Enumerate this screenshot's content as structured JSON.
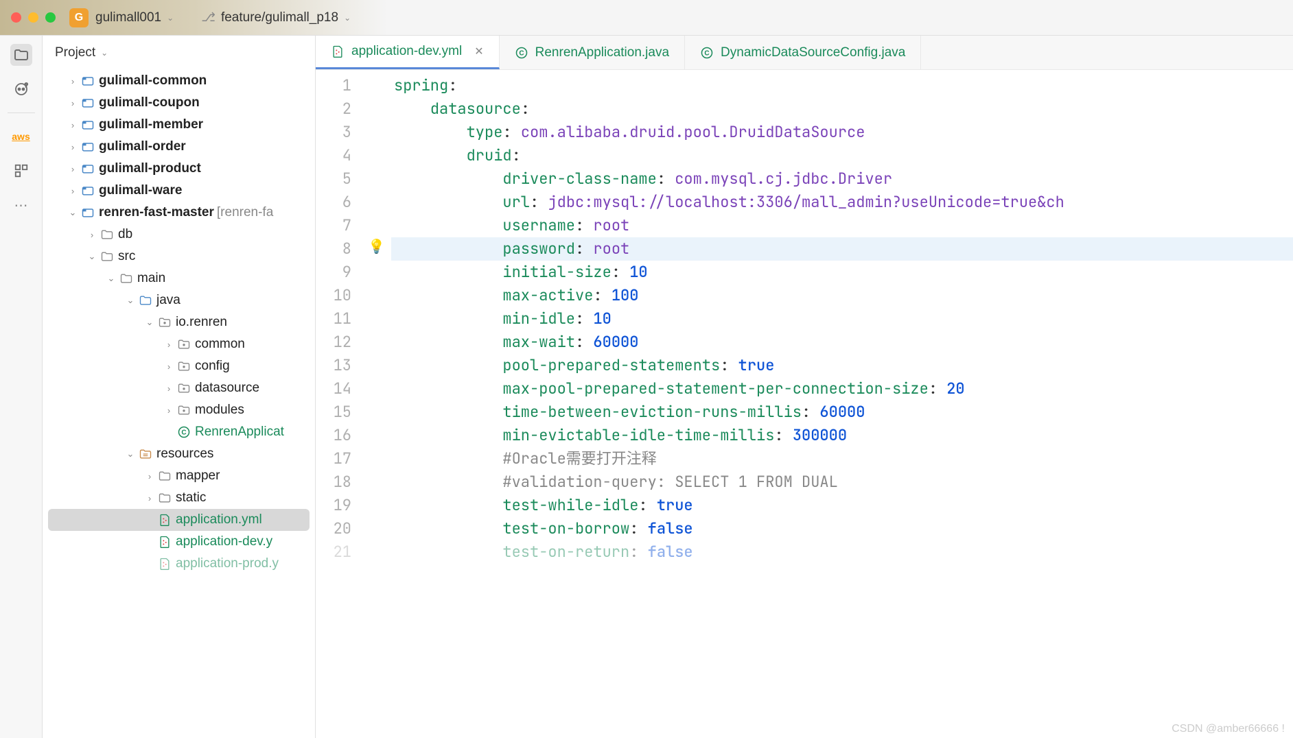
{
  "titlebar": {
    "project_badge": "G",
    "project_name": "gulimall001",
    "branch_name": "feature/gulimall_p18"
  },
  "leftbar": {
    "icons": [
      "folder",
      "copilot",
      "aws",
      "structure",
      "more"
    ]
  },
  "panel": {
    "title": "Project"
  },
  "tree": [
    {
      "indent": 1,
      "arrow": "right",
      "icon": "module",
      "label": "gulimall-common",
      "bold": true
    },
    {
      "indent": 1,
      "arrow": "right",
      "icon": "module",
      "label": "gulimall-coupon",
      "bold": true
    },
    {
      "indent": 1,
      "arrow": "right",
      "icon": "module",
      "label": "gulimall-member",
      "bold": true
    },
    {
      "indent": 1,
      "arrow": "right",
      "icon": "module",
      "label": "gulimall-order",
      "bold": true
    },
    {
      "indent": 1,
      "arrow": "right",
      "icon": "module",
      "label": "gulimall-product",
      "bold": true
    },
    {
      "indent": 1,
      "arrow": "right",
      "icon": "module",
      "label": "gulimall-ware",
      "bold": true
    },
    {
      "indent": 1,
      "arrow": "down",
      "icon": "module",
      "label": "renren-fast-master",
      "bold": true,
      "annot": " [renren-fa"
    },
    {
      "indent": 2,
      "arrow": "right",
      "icon": "dir",
      "label": "db"
    },
    {
      "indent": 2,
      "arrow": "down",
      "icon": "dir",
      "label": "src"
    },
    {
      "indent": 3,
      "arrow": "down",
      "icon": "dir",
      "label": "main"
    },
    {
      "indent": 4,
      "arrow": "down",
      "icon": "srcfolder",
      "label": "java"
    },
    {
      "indent": 5,
      "arrow": "down",
      "icon": "pkg",
      "label": "io.renren"
    },
    {
      "indent": 6,
      "arrow": "right",
      "icon": "pkg",
      "label": "common"
    },
    {
      "indent": 6,
      "arrow": "right",
      "icon": "pkg",
      "label": "config"
    },
    {
      "indent": 6,
      "arrow": "right",
      "icon": "pkg",
      "label": "datasource"
    },
    {
      "indent": 6,
      "arrow": "right",
      "icon": "pkg",
      "label": "modules"
    },
    {
      "indent": 6,
      "arrow": "none",
      "icon": "class",
      "label": "RenrenApplicat",
      "green": true
    },
    {
      "indent": 4,
      "arrow": "down",
      "icon": "resfolder",
      "label": "resources"
    },
    {
      "indent": 5,
      "arrow": "right",
      "icon": "folder",
      "label": "mapper"
    },
    {
      "indent": 5,
      "arrow": "right",
      "icon": "folder",
      "label": "static"
    },
    {
      "indent": 5,
      "arrow": "none",
      "icon": "yml",
      "label": "application.yml",
      "green": true,
      "selected": true
    },
    {
      "indent": 5,
      "arrow": "none",
      "icon": "yml",
      "label": "application-dev.yml",
      "green": true,
      "trunc": "application-dev.y"
    },
    {
      "indent": 5,
      "arrow": "none",
      "icon": "yml",
      "label": "application-prod.yml",
      "green": true,
      "trunc": "application-prod.y",
      "faded": true
    }
  ],
  "tabs": [
    {
      "icon": "yml",
      "label": "application-dev.yml",
      "active": true,
      "closable": true
    },
    {
      "icon": "class",
      "label": "RenrenApplication.java"
    },
    {
      "icon": "class",
      "label": "DynamicDataSourceConfig.java"
    }
  ],
  "code_lines": [
    {
      "n": 1,
      "segs": [
        [
          "k",
          "spring"
        ],
        [
          "colon",
          ":"
        ]
      ]
    },
    {
      "n": 2,
      "segs": [
        [
          "",
          "    "
        ],
        [
          "k",
          "datasource"
        ],
        [
          "colon",
          ":"
        ]
      ]
    },
    {
      "n": 3,
      "segs": [
        [
          "",
          "        "
        ],
        [
          "k",
          "type"
        ],
        [
          "colon",
          ": "
        ],
        [
          "s",
          "com.alibaba.druid.pool.DruidDataSource"
        ]
      ]
    },
    {
      "n": 4,
      "segs": [
        [
          "",
          "        "
        ],
        [
          "k",
          "druid"
        ],
        [
          "colon",
          ":"
        ]
      ]
    },
    {
      "n": 5,
      "segs": [
        [
          "",
          "            "
        ],
        [
          "k",
          "driver-class-name"
        ],
        [
          "colon",
          ": "
        ],
        [
          "s",
          "com.mysql.cj.jdbc.Driver"
        ]
      ]
    },
    {
      "n": 6,
      "segs": [
        [
          "",
          "            "
        ],
        [
          "k",
          "url"
        ],
        [
          "colon",
          ": "
        ],
        [
          "s",
          "jdbc:mysql://localhost:3306/mall_admin?useUnicode=true&ch"
        ]
      ]
    },
    {
      "n": 7,
      "segs": [
        [
          "",
          "            "
        ],
        [
          "k",
          "username"
        ],
        [
          "colon",
          ": "
        ],
        [
          "s",
          "root"
        ]
      ]
    },
    {
      "n": 8,
      "hl": true,
      "segs": [
        [
          "",
          "            "
        ],
        [
          "k",
          "password"
        ],
        [
          "colon",
          ": "
        ],
        [
          "s",
          "root"
        ]
      ]
    },
    {
      "n": 9,
      "segs": [
        [
          "",
          "            "
        ],
        [
          "k",
          "initial-size"
        ],
        [
          "colon",
          ": "
        ],
        [
          "v",
          "10"
        ]
      ]
    },
    {
      "n": 10,
      "segs": [
        [
          "",
          "            "
        ],
        [
          "k",
          "max-active"
        ],
        [
          "colon",
          ": "
        ],
        [
          "v",
          "100"
        ]
      ]
    },
    {
      "n": 11,
      "segs": [
        [
          "",
          "            "
        ],
        [
          "k",
          "min-idle"
        ],
        [
          "colon",
          ": "
        ],
        [
          "v",
          "10"
        ]
      ]
    },
    {
      "n": 12,
      "segs": [
        [
          "",
          "            "
        ],
        [
          "k",
          "max-wait"
        ],
        [
          "colon",
          ": "
        ],
        [
          "v",
          "60000"
        ]
      ]
    },
    {
      "n": 13,
      "segs": [
        [
          "",
          "            "
        ],
        [
          "k",
          "pool-prepared-statements"
        ],
        [
          "colon",
          ": "
        ],
        [
          "v",
          "true"
        ]
      ]
    },
    {
      "n": 14,
      "segs": [
        [
          "",
          "            "
        ],
        [
          "k",
          "max-pool-prepared-statement-per-connection-size"
        ],
        [
          "colon",
          ": "
        ],
        [
          "v",
          "20"
        ]
      ]
    },
    {
      "n": 15,
      "segs": [
        [
          "",
          "            "
        ],
        [
          "k",
          "time-between-eviction-runs-millis"
        ],
        [
          "colon",
          ": "
        ],
        [
          "v",
          "60000"
        ]
      ]
    },
    {
      "n": 16,
      "segs": [
        [
          "",
          "            "
        ],
        [
          "k",
          "min-evictable-idle-time-millis"
        ],
        [
          "colon",
          ": "
        ],
        [
          "v",
          "300000"
        ]
      ]
    },
    {
      "n": 17,
      "segs": [
        [
          "",
          "            "
        ],
        [
          "c",
          "#Oracle需要打开注释"
        ]
      ]
    },
    {
      "n": 18,
      "segs": [
        [
          "",
          "            "
        ],
        [
          "c",
          "#validation-query: SELECT 1 FROM DUAL"
        ]
      ]
    },
    {
      "n": 19,
      "segs": [
        [
          "",
          "            "
        ],
        [
          "k",
          "test-while-idle"
        ],
        [
          "colon",
          ": "
        ],
        [
          "v",
          "true"
        ]
      ]
    },
    {
      "n": 20,
      "segs": [
        [
          "",
          "            "
        ],
        [
          "k",
          "test-on-borrow"
        ],
        [
          "colon",
          ": "
        ],
        [
          "v",
          "false"
        ]
      ]
    },
    {
      "n": 21,
      "faded": true,
      "segs": [
        [
          "",
          "            "
        ],
        [
          "k",
          "test-on-return"
        ],
        [
          "colon",
          ": "
        ],
        [
          "v",
          "false"
        ]
      ]
    }
  ],
  "watermark": "CSDN @amber66666 !"
}
